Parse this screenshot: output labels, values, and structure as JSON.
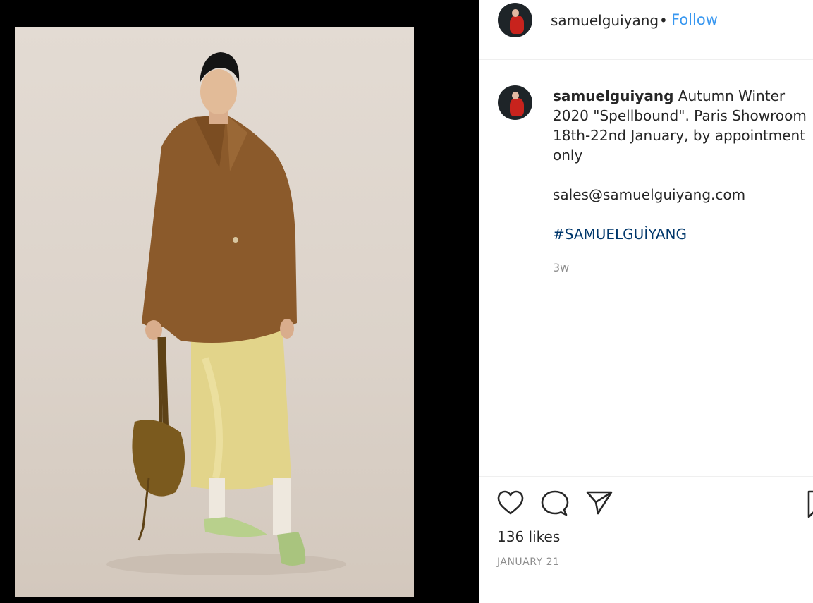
{
  "post": {
    "author": "samuelguiyang",
    "separator": "•",
    "follow_label": "Follow",
    "caption": {
      "username": "samuelguiyang",
      "text": "Autumn Winter 2020 \"Spellbound\". Paris Showroom 18th-22nd January, by appointment only",
      "email": "sales@samuelguiyang.com",
      "hashtag": "#SAMUELGUÌYANG",
      "age": "3w"
    },
    "likes": "136 likes",
    "date": "JANUARY 21"
  },
  "icons": {
    "like": "heart-icon",
    "comment": "comment-bubble-icon",
    "share": "paper-plane-icon",
    "save": "bookmark-icon"
  },
  "colors": {
    "media_background": "#000000",
    "follow_link": "#3897f0",
    "hashtag": "#00376b",
    "muted_text": "#8e8e8e",
    "divider": "#efefef"
  }
}
